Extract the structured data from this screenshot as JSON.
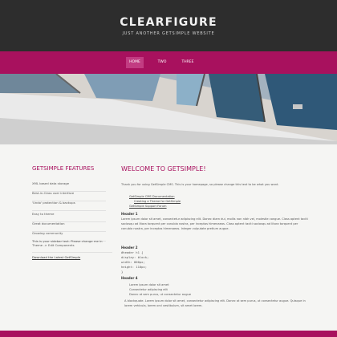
{
  "site": {
    "title": "CLEARFIGURE",
    "tagline": "JUST ANOTHER GETSIMPLE WEBSITE"
  },
  "nav": {
    "items": [
      {
        "label": "HOME",
        "active": true
      },
      {
        "label": "TWO",
        "active": false
      },
      {
        "label": "THREE",
        "active": false
      }
    ]
  },
  "sidebar": {
    "title": "GETSIMPLE FEATURES",
    "items": [
      "XML based data storage",
      "Best-in-Class user interface",
      "'Undo' protection & backups",
      "Easy to theme",
      "Great documentation",
      "Growing community",
      "This is your sidebar text. Please change me in Theme -> Edit Components"
    ],
    "download_label": "Download the Latest GetSimple"
  },
  "main": {
    "title": "WELCOME TO GETSIMPLE!",
    "intro": "Thank you for using GetSimple CMS. This is your homepage, so please change this text to be what you want.",
    "links": [
      "GetSimple CMS Documentation",
      "Creating a Theme for GetSimple",
      "GetSimple Support Forum"
    ],
    "header1": "Header 1",
    "lorem": "Lorem ipsum dolor sit amet, consectetur adipiscing elit. Donec diam dui, mollis non nibh vel, molestie congue. Class aptent taciti sociosqu ad litora torquent per conubia nostra, per inceptos himenaeos. Class aptent taciti sociosqu ad litora torquent per conubia nostra, per inceptos himenaeos. Integer vulputate pretium augue.",
    "header2": "Header 2",
    "code": [
      "#header h1 {",
      "  display: block;",
      "  width: 800px;",
      "  height: 110px;",
      "}"
    ],
    "header4": "Header 4",
    "list": [
      "Lorem ipsum dolor sit amet",
      "Consectetur adipiscing elit",
      "Donec at sem purus, ut consectetur augue"
    ],
    "blockquote": "A blockquote. Lorem ipsum dolor sit amet, consectetur adipiscing elit. Donec at sem purus, ut consectetur augue. Quisque in lorem vehicula, lorem orci vestibulum, sit amet lorem."
  },
  "colors": {
    "accent": "#a8115e",
    "header_bg": "#2d2d2d",
    "body_bg": "#f5f5f3"
  }
}
